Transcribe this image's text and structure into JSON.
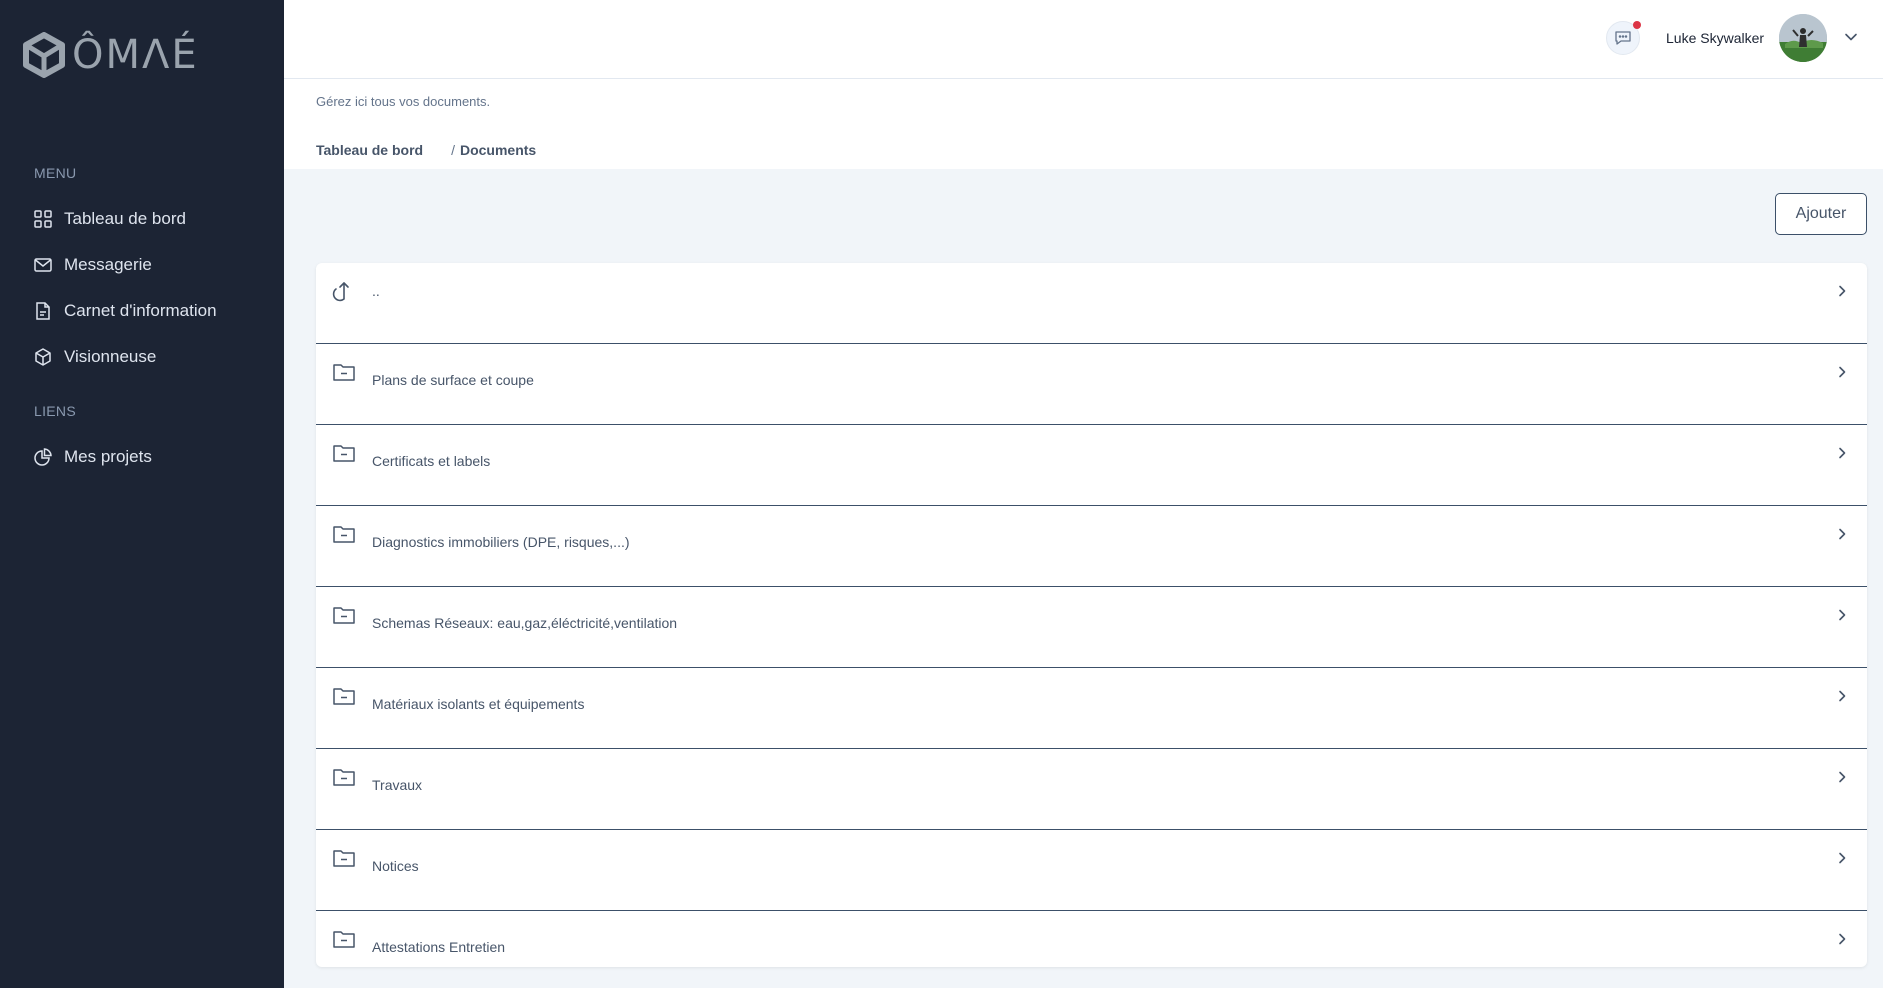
{
  "brand": {
    "name": "ÔMΛÉ"
  },
  "sidebar": {
    "menu_title": "MENU",
    "menu_items": [
      {
        "label": "Tableau de bord",
        "icon": "grid-icon"
      },
      {
        "label": "Messagerie",
        "icon": "mail-icon"
      },
      {
        "label": "Carnet d'information",
        "icon": "document-icon"
      },
      {
        "label": "Visionneuse",
        "icon": "cube-icon"
      }
    ],
    "links_title": "LIENS",
    "link_items": [
      {
        "label": "Mes projets",
        "icon": "pie-chart-icon"
      }
    ]
  },
  "topbar": {
    "user_name": "Luke Skywalker",
    "notification": true
  },
  "page": {
    "subtitle": "Gérez ici tous vos documents.",
    "breadcrumb": {
      "home": "Tableau de bord",
      "separator": "/",
      "current": "Documents"
    },
    "add_label": "Ajouter"
  },
  "folders": {
    "up": {
      "label": "..",
      "icon": "arrow-up-icon"
    },
    "items": [
      {
        "label": "Plans de surface et coupe"
      },
      {
        "label": "Certificats et labels"
      },
      {
        "label": "Diagnostics immobiliers (DPE, risques,...)"
      },
      {
        "label": "Schemas Réseaux: eau,gaz,éléctricité,ventilation"
      },
      {
        "label": "Matériaux isolants et équipements"
      },
      {
        "label": "Travaux"
      },
      {
        "label": "Notices"
      },
      {
        "label": "Attestations Entretien"
      }
    ]
  },
  "colors": {
    "sidebar_bg": "#1c2434",
    "page_bg": "#f1f5f9",
    "row_border": "#3c5069",
    "notification_dot": "#dc3545"
  }
}
